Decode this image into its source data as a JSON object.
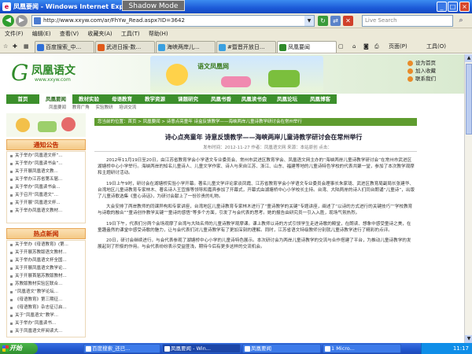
{
  "window": {
    "title": "凤凰要闻 - Windows Internet Explorer",
    "shadow_mode": "Shadow Mode",
    "minimize": "_",
    "maximize": "□",
    "close": "×"
  },
  "address_bar": {
    "url": "http://www.xxyw.com/ar/FhYw_Read.aspx?ID=3642",
    "search_placeholder": "Live Search",
    "search_icon": "⌕"
  },
  "menu": [
    "文件(F)",
    "编辑(E)",
    "查看(V)",
    "收藏夹(A)",
    "工具(T)",
    "帮助(H)"
  ],
  "tabs": [
    {
      "label": "百度搜索_中...",
      "color": "#2f6fd8"
    },
    {
      "label": "武进日报-数...",
      "color": "#e05a1a"
    },
    {
      "label": "海峡两岸儿...",
      "color": "#3aa0e0"
    },
    {
      "label": "#暨晋开放日...",
      "color": "#3aa0e0"
    },
    {
      "label": "凤凰要闻",
      "color": "#2f8a2a"
    }
  ],
  "tab_tools": {
    "page": "页面(P)",
    "tools": "工具(O)"
  },
  "site": {
    "logo_char": "G",
    "logo_name": "凤凰语文",
    "logo_url": "www.xxyw.com",
    "banner_text": "语文凤凰网",
    "header_links": [
      "设为首页",
      "加入收藏",
      "联系我们"
    ],
    "nav": [
      "首页",
      "凤凰要闻",
      "教材实验",
      "母语教育",
      "教学资源",
      "课题研究",
      "凤凰书香",
      "凤凰读书会",
      "凤凰论坛",
      "凤凰博客"
    ],
    "nav_active": 1,
    "subnav": [
      "凤凰要闻",
      "教育广角",
      "实验教研",
      "培训交流"
    ],
    "notice_title": "通知公告",
    "notices": [
      "关于举办“凤凰语文杯”...",
      "关于举办“凤凰读书会”...",
      "关于开展凤凰语文教...",
      "关于举办江苏省第五届...",
      "关于举办“凤凰读书会...",
      "关于召开“凤凰语文”...",
      "关于开展“凤凰语文杯...",
      "关于举办凤凰语文教材..."
    ],
    "news_title": "热点新闻",
    "news": [
      "关于举办《母语教育》(第...",
      "关于开展苏教版语文教材...",
      "关于举办凤凰语文杯全国...",
      "关于开展凤凰语文教学论...",
      "关于开展首届苏教版教材...",
      "苏教版教材实验区联合...",
      "“凤凰语文”教学论坛...",
      "《母语教育》第三期征...",
      "《母语教育》杂志征订启...",
      "关于“凤凰语文”教学...",
      "关于举办“凤凰读书...",
      "关于凤凰语文杯阅读大..."
    ]
  },
  "article": {
    "breadcrumb": "您当前的位置：首页 > 凤凰要闻 > 诗意点亮童年 诗盒反馈教学——海峡两岸儿童诗教学研讨会在常州举行",
    "title": "诗心点亮童年 诗意反馈教学——海峡两岸儿童诗教学研讨会在常州举行",
    "meta": "发布时间：2012-11-27  作者：凤凰语文网  来源：本站原创  点击：",
    "paragraphs": [
      "2012年11月19日至20日，由江苏省教育学会小学语文专业委员会、常州市武进区教育学会、凤凰语文网主办的“海峡两岸儿童诗教学研讨会”在常州市武进区湖塘桥中心小学举行。海峡两岸的知名儿童诗人、儿童文学作家、诗人与来自江苏、浙江、山东、福建等地的儿童诗特色学校的代表共聚一堂，参加了本次教学观摩和主题研讨活动。",
      "19日上午9时，研讨会在湖塘桥实验小学开幕。著名儿童文学评论家谈凤霞、江苏省教育学会小学语文专业委员会理事长朱家珑、武进区教育局副局长张建华、台湾地区儿童诗教育专家林木、著名诗人王宜振等领导和嘉宾参加了开幕式，开幕式由湖塘桥中心小学校长主持。台湾、大陆两岸的诗人们同台朗诵“儿童诗”，出版了儿童诗歌选集《童心诗话》，为研讨会献上了一份珍贵的礼物。",
      "大会安排了两岸教师的同课异构和专家讲座，台湾地区儿童诗教育专家林木进行了“童诗教学的关键”专题讲座，阐述了“以诗的方式进行的关键技巧”“学校教育与诗歌的融合”“童诗创作教学关键”“童诗的感悟”等多个方面，引发了与会代表的思考。她的报告由研究员一引入入胜，现场气氛热烈。",
      "19日下午，代表们分两个会场观摩了台湾与大陆名师的儿童诗教学观摩课。课上教师以诗的方式引领学生走进诗歌的殿堂，在朗读、想象中感受童诗之美，在童趣盎然的课堂中感受诗歌的魅力，让与会代表们对儿童诗教学有了更加深刻的理解。同时，江苏省语文特级教师分别就儿童诗教学进行了精彩的点评。",
      "20日，研讨会继续进行，与会代表参观了湖塘桥中心小学的儿童诗特色展示。本次研讨会为两岸儿童诗教学的交流与合作搭建了平台，为推动儿童诗教学的发展起到了积极的作用。与会代表纷纷表示受益匪浅，期待今后有更多这样的交流机会。"
    ]
  },
  "status": {
    "done": "完成",
    "zone": "Internet",
    "zoom": "75%"
  },
  "taskbar": {
    "start": "开始",
    "items": [
      {
        "label": "百度搜索_还已...",
        "active": false
      },
      {
        "label": "凤凰要闻 - Win...",
        "active": true
      },
      {
        "label": "凤凰要闻",
        "active": false
      },
      {
        "label": "1 Micro...",
        "active": false
      }
    ],
    "clock": "11:17"
  }
}
